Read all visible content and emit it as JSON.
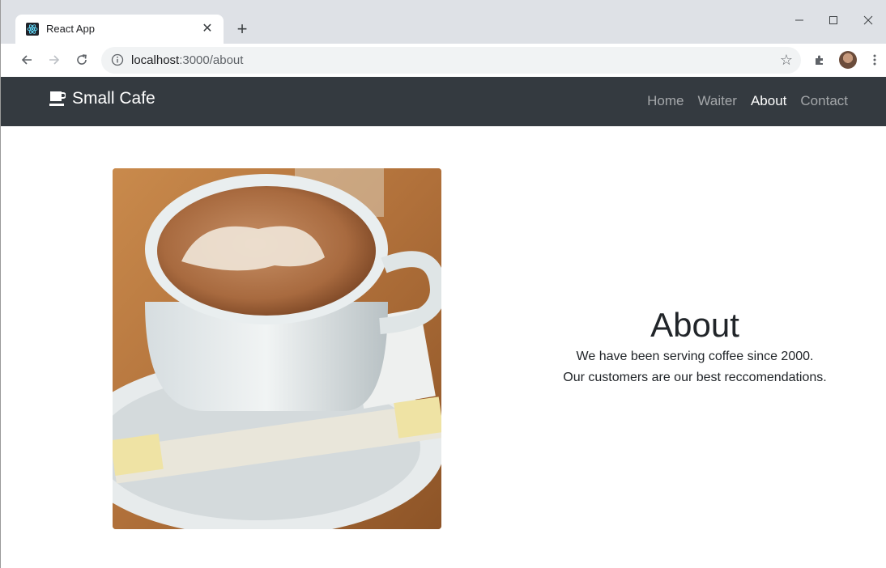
{
  "browser": {
    "tab_title": "React App",
    "url_host": "localhost",
    "url_path": ":3000/about"
  },
  "navbar": {
    "brand": "Small Cafe",
    "links": [
      "Home",
      "Waiter",
      "About",
      "Contact"
    ],
    "active": "About"
  },
  "about": {
    "title": "About",
    "line1": "We have been serving coffee since 2000.",
    "line2": "Our customers are our best reccomendations."
  },
  "colors": {
    "navbar_bg": "#343a40",
    "tabstrip_bg": "#dee1e6"
  },
  "icons": [
    "react-favicon-icon",
    "close-icon",
    "plus-icon",
    "minimize-icon",
    "maximize-icon",
    "window-close-icon",
    "back-icon",
    "forward-icon",
    "reload-icon",
    "info-icon",
    "star-icon",
    "extensions-icon",
    "avatar",
    "more-icon",
    "coffee-cup-icon"
  ]
}
